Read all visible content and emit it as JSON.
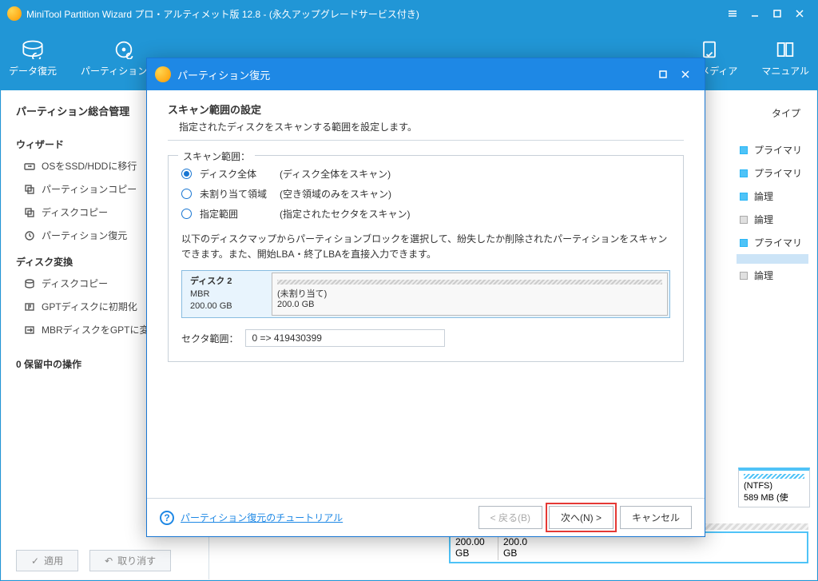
{
  "main": {
    "title": "MiniTool Partition Wizard プロ・アルティメット版 12.8 - (永久アップグレードサービス付き)"
  },
  "toolbar": {
    "data_recovery": "データ復元",
    "partition_recovery": "パーティション復元",
    "bootable_media": "ブルメディア",
    "manual": "マニュアル"
  },
  "sidebar": {
    "header": "パーティション総合管理",
    "wizard_section": "ウィザード",
    "items": {
      "os_migrate": "OSをSSD/HDDに移行",
      "partition_copy": "パーティションコピー",
      "disk_copy": "ディスクコピー",
      "partition_recover": "パーティション復元"
    },
    "disk_section": "ディスク変換",
    "disk_items": {
      "disk_copy": "ディスクコピー",
      "gpt_init": "GPTディスクに初期化",
      "mbr_to_gpt": "MBRディスクをGPTに変"
    },
    "pending": "0 保留中の操作",
    "apply": "適用",
    "undo": "取り消す"
  },
  "right": {
    "type_col": "タイプ",
    "primary": "プライマリ",
    "logical": "論理",
    "ntfs_label": "(NTFS)",
    "ntfs_size": "589 MB (使",
    "bottom_size": "200.00 GB",
    "bottom_size2": "200.0 GB"
  },
  "modal": {
    "title": "パーティション復元",
    "heading": "スキャン範囲の設定",
    "sub": "指定されたディスクをスキャンする範囲を設定します。",
    "fieldset_legend": "スキャン範囲：",
    "radios": {
      "full": {
        "label": "ディスク全体",
        "desc": "(ディスク全体をスキャン)"
      },
      "unalloc": {
        "label": "未割り当て領域",
        "desc": "(空き領域のみをスキャン)"
      },
      "range": {
        "label": "指定範囲",
        "desc": "(指定されたセクタをスキャン)"
      }
    },
    "desc_text": "以下のディスクマップからパーティションブロックを選択して、紛失したか削除されたパーティションをスキャンできます。また、開始LBA・終了LBAを直接入力できます。",
    "disk": {
      "name": "ディスク 2",
      "type": "MBR",
      "size": "200.00 GB",
      "alloc": "(未割り当て)",
      "alloc_size": "200.0 GB"
    },
    "sector_label": "セクタ範囲：",
    "sector_value": "0 => 419430399",
    "tutorial": "パーティション復元のチュートリアル",
    "back": "< 戻る(B)",
    "next": "次へ(N) >",
    "cancel": "キャンセル"
  }
}
